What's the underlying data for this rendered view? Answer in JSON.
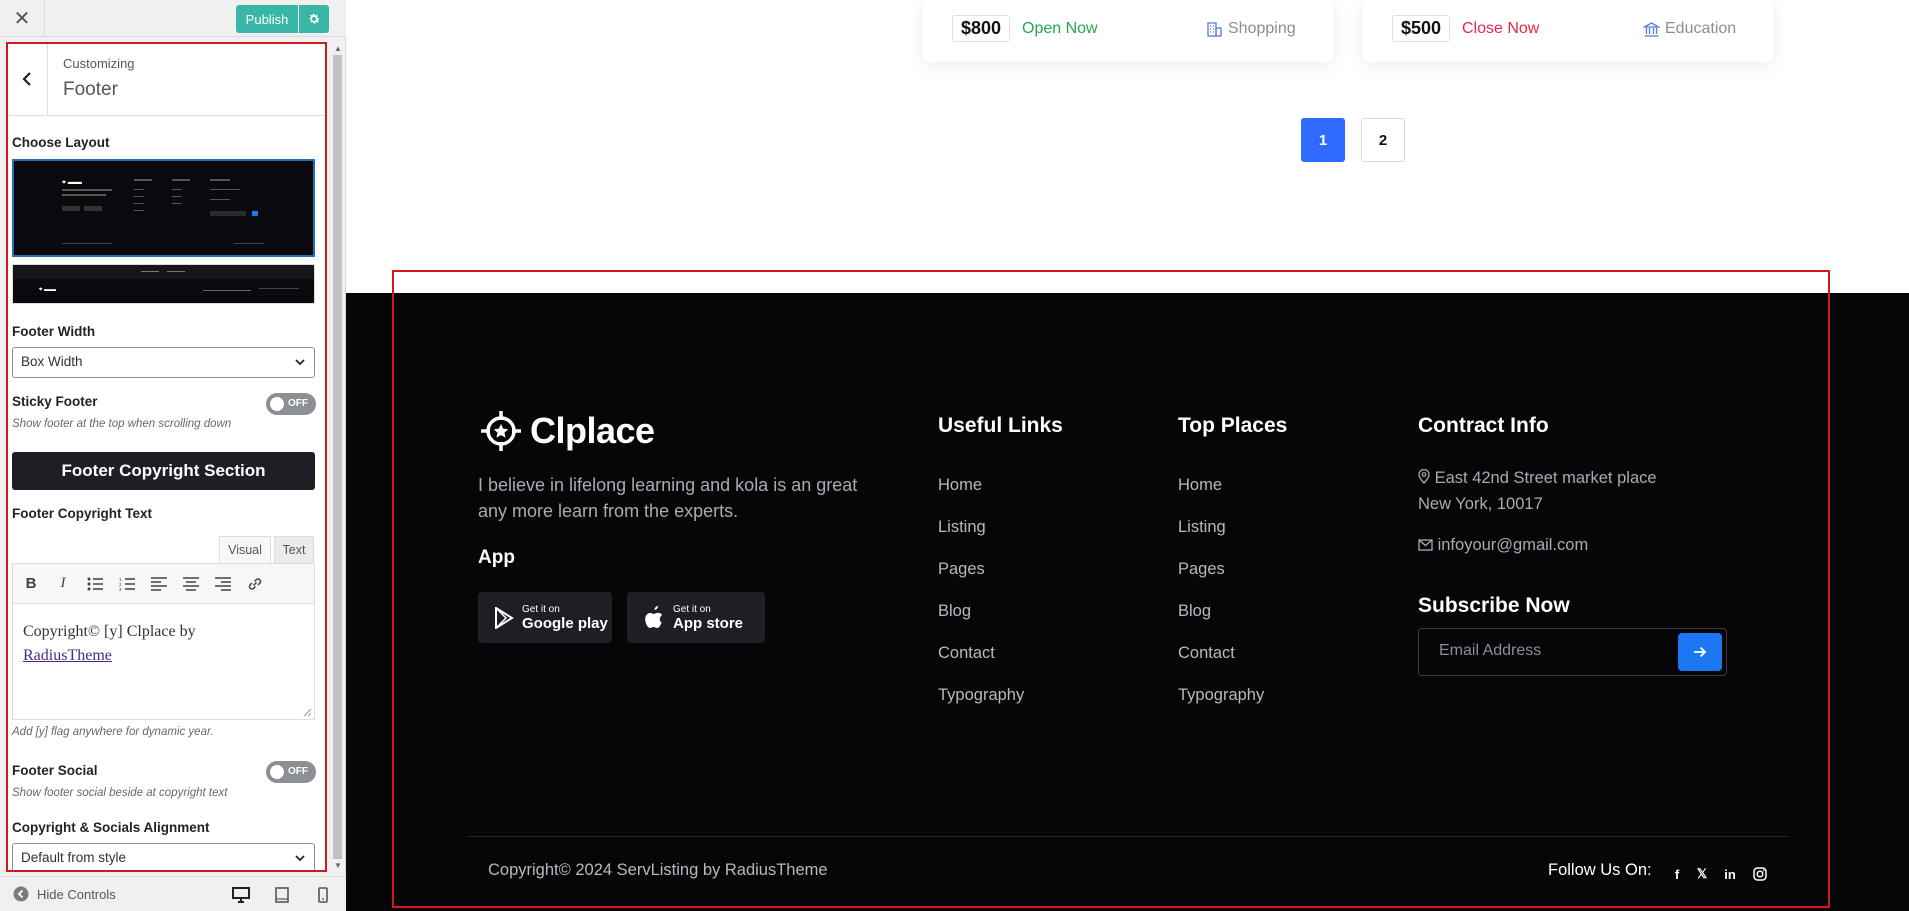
{
  "customizer": {
    "close_icon": "close-icon",
    "publish_label": "Publish",
    "breadcrumb": "Customizing",
    "section_title": "Footer",
    "choose_layout_label": "Choose Layout",
    "footer_width_label": "Footer Width",
    "footer_width_value": "Box Width",
    "sticky_footer_label": "Sticky Footer",
    "sticky_footer_state": "OFF",
    "sticky_footer_desc": "Show footer at the top when scrolling down",
    "copyright_section_label": "Footer Copyright Section",
    "copyright_text_label": "Footer Copyright Text",
    "tab_visual": "Visual",
    "tab_text": "Text",
    "editor_text_before": "Copyright© [y] Clplace by",
    "editor_link": "RadiusTheme",
    "copyright_desc": "Add [y] flag anywhere for dynamic year.",
    "footer_social_label": "Footer Social",
    "footer_social_state": "OFF",
    "footer_social_desc": "Show footer social beside at copyright text",
    "alignment_label": "Copyright & Socials Alignment",
    "alignment_value": "Default from style",
    "hide_controls": "Hide Controls"
  },
  "cards": [
    {
      "price": "$800",
      "status": "Open Now",
      "status_color": "#22a94f",
      "category": "Shopping"
    },
    {
      "price": "$500",
      "status": "Close Now",
      "status_color": "#e8274b",
      "category": "Education"
    }
  ],
  "pagination": [
    "1",
    "2"
  ],
  "footer": {
    "brand": "Clplace",
    "description": "I believe in lifelong learning and kola is an great any more learn from the experts.",
    "app_title": "App",
    "google_small": "Get it on",
    "google_big": "Google play",
    "apple_small": "Get it on",
    "apple_big": "App store",
    "useful_links_title": "Useful Links",
    "useful_links": [
      "Home",
      "Listing",
      "Pages",
      "Blog",
      "Contact",
      "Typography"
    ],
    "top_places_title": "Top Places",
    "top_places": [
      "Home",
      "Listing",
      "Pages",
      "Blog",
      "Contact",
      "Typography"
    ],
    "contact_title": "Contract Info",
    "address_line1": "East 42nd Street market place",
    "address_line2": "New York, 10017",
    "email": "infoyour@gmail.com",
    "subscribe_title": "Subscribe Now",
    "email_placeholder": "Email Address",
    "copyright": "Copyright© 2024 ServListing by RadiusTheme",
    "follow_label": "Follow Us On:"
  },
  "colors": {
    "accent_blue": "#2f6bff",
    "publish_teal": "#3ab6a6",
    "highlight_red": "#d4161d"
  }
}
